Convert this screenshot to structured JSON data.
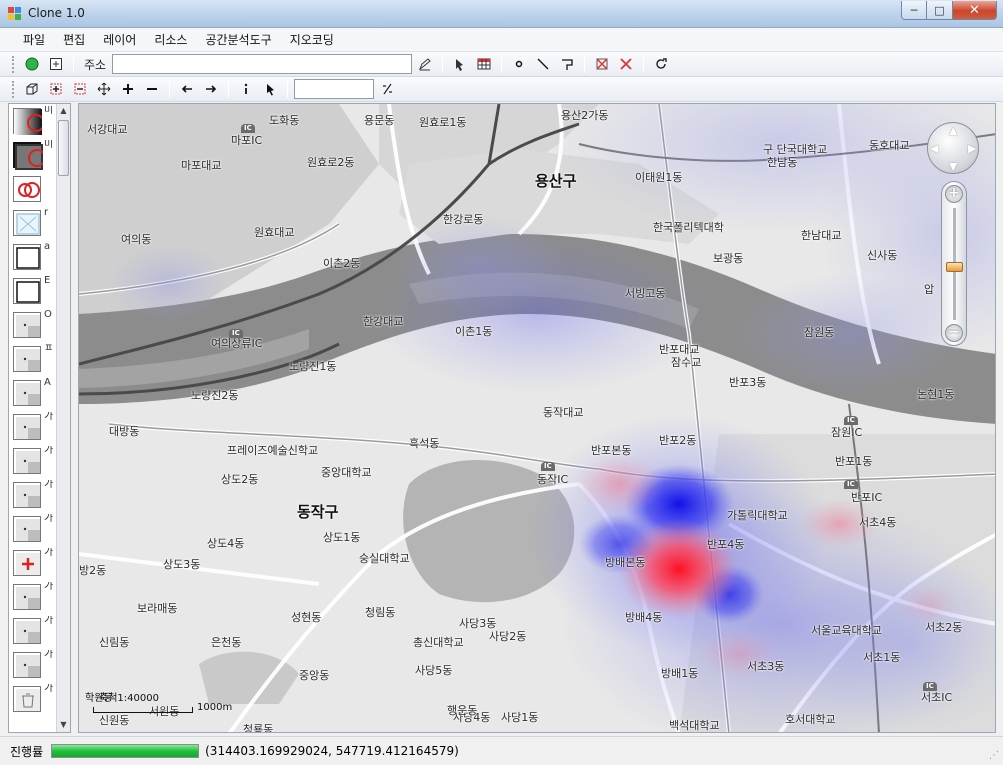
{
  "window": {
    "title": "Clone 1.0",
    "min": "─",
    "max": "□",
    "close": "✕"
  },
  "menu": [
    "파일",
    "편집",
    "레이어",
    "리소스",
    "공간분석도구",
    "지오코딩"
  ],
  "toolbar1": {
    "address_label": "주소",
    "address_value": ""
  },
  "toolbar2": {
    "field_value": ""
  },
  "layers": [
    {
      "text": "미",
      "style": "dark-red"
    },
    {
      "text": "미",
      "style": "dark-red-sel"
    },
    {
      "text": "",
      "style": "red-rings"
    },
    {
      "text": "r",
      "style": "blue-box"
    },
    {
      "text": "a",
      "style": "square"
    },
    {
      "text": "E",
      "style": "square"
    },
    {
      "text": "O",
      "style": "gray"
    },
    {
      "text": "ㅍ",
      "style": "gray"
    },
    {
      "text": "A",
      "style": "gray"
    },
    {
      "text": "가",
      "style": "gray"
    },
    {
      "text": "가",
      "style": "gray"
    },
    {
      "text": "가",
      "style": "gray"
    },
    {
      "text": "가",
      "style": "gray"
    },
    {
      "text": "가",
      "style": "red-cross"
    },
    {
      "text": "가",
      "style": "gray"
    },
    {
      "text": "가",
      "style": "gray"
    },
    {
      "text": "가",
      "style": "gray"
    },
    {
      "text": "가",
      "style": "trash"
    }
  ],
  "map": {
    "districts": [
      {
        "name": "용산구"
      },
      {
        "name": "동작구"
      }
    ],
    "places": [
      "서강대교",
      "도화동",
      "용문동",
      "원효로1동",
      "용산2가동",
      "마포IC",
      "마포대교",
      "원효로2동",
      "이태원1동",
      "구 단국대학교",
      "한남동",
      "동호대교",
      "한강로동",
      "한국폴리텍대학",
      "여의동",
      "원효대교",
      "이촌2동",
      "한남대교",
      "보광동",
      "신사동",
      "압",
      "서빙고동",
      "한강대교",
      "이촌1동",
      "잠원동",
      "여의상류IC",
      "반포대교",
      "잠수교",
      "노량진1동",
      "반포3동",
      "노량진2동",
      "동작대교",
      "논현1동",
      "대방동",
      "반포2동",
      "잠원IC",
      "프레이즈예술신학교",
      "흑석동",
      "반포본동",
      "반포1동",
      "중앙대학교",
      "동작IC",
      "상도2동",
      "반포IC",
      "가톨릭대학교",
      "서초4동",
      "상도1동",
      "반포4동",
      "상도4동",
      "숭실대학교",
      "방배본동",
      "상도3동",
      "방2동",
      "보라매동",
      "성현동",
      "청림동",
      "방배4동",
      "사당3동",
      "신림동",
      "은천동",
      "총신대학교",
      "사당2동",
      "서울교육대학교",
      "서초2동",
      "사당5동",
      "중앙동",
      "방배1동",
      "서초3동",
      "서초1동",
      "서초IC",
      "사당4동",
      "사당1동",
      "행운동",
      "백석대학교",
      "호서대학교",
      "청룡동",
      "신원동",
      "서원동"
    ],
    "scale_text": "축척1:40000",
    "scale_label": "1000m",
    "map_label": "학원동"
  },
  "status": {
    "label": "진행률",
    "progress": 1.0,
    "coords": "(314403.169929024, 547719.412164579)"
  }
}
